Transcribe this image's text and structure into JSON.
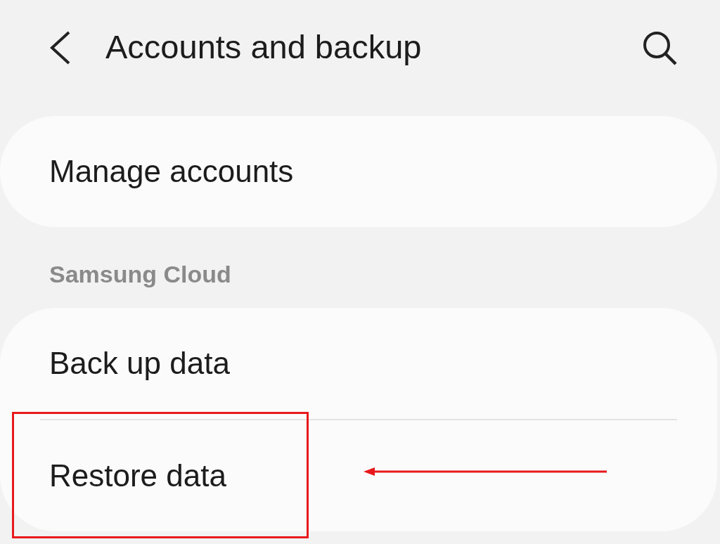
{
  "header": {
    "title": "Accounts and backup"
  },
  "sections": [
    {
      "items": [
        {
          "label": "Manage accounts",
          "highlighted": false
        }
      ]
    },
    {
      "heading": "Samsung Cloud",
      "items": [
        {
          "label": "Back up data",
          "highlighted": false
        },
        {
          "label": "Restore data",
          "highlighted": true
        }
      ]
    }
  ]
}
